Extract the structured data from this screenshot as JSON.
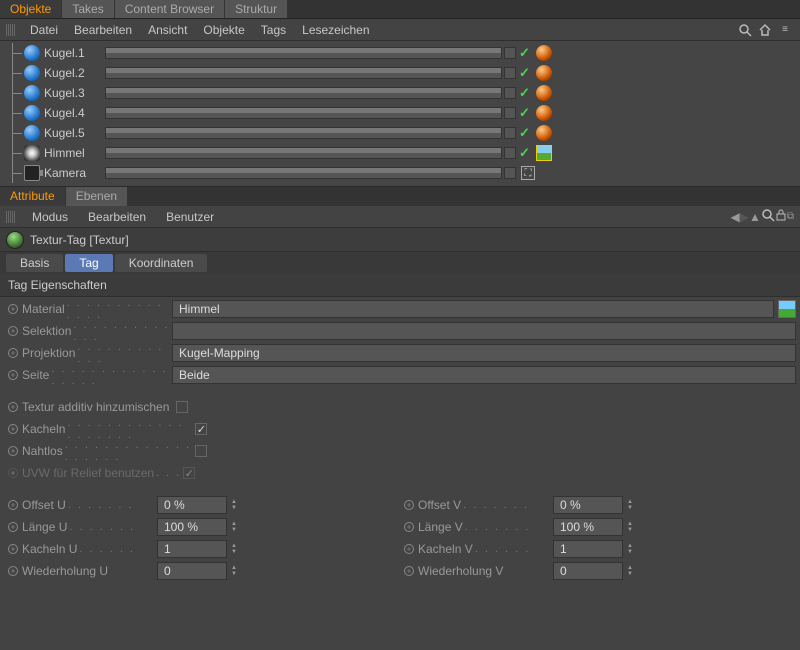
{
  "topTabs": {
    "active": "Objekte",
    "items": [
      "Objekte",
      "Takes",
      "Content Browser",
      "Struktur"
    ]
  },
  "objMenu": [
    "Datei",
    "Bearbeiten",
    "Ansicht",
    "Objekte",
    "Tags",
    "Lesezeichen"
  ],
  "objects": [
    {
      "name": "Kugel.1",
      "type": "sphere"
    },
    {
      "name": "Kugel.2",
      "type": "sphere"
    },
    {
      "name": "Kugel.3",
      "type": "sphere"
    },
    {
      "name": "Kugel.4",
      "type": "sphere"
    },
    {
      "name": "Kugel.5",
      "type": "sphere"
    },
    {
      "name": "Himmel",
      "type": "sky"
    },
    {
      "name": "Kamera",
      "type": "camera"
    }
  ],
  "attrTabs": {
    "active": "Attribute",
    "items": [
      "Attribute",
      "Ebenen"
    ]
  },
  "attrMenu": [
    "Modus",
    "Bearbeiten",
    "Benutzer"
  ],
  "headTitle": "Textur-Tag [Textur]",
  "subTabs": [
    "Basis",
    "Tag",
    "Koordinaten"
  ],
  "subActive": "Tag",
  "sectionTitle": "Tag Eigenschaften",
  "props": {
    "material": {
      "label": "Material",
      "value": "Himmel"
    },
    "selektion": {
      "label": "Selektion",
      "value": ""
    },
    "projektion": {
      "label": "Projektion",
      "value": "Kugel-Mapping"
    },
    "seite": {
      "label": "Seite",
      "value": "Beide"
    },
    "additiv": {
      "label": "Textur additiv hinzumischen",
      "checked": false
    },
    "kacheln": {
      "label": "Kacheln",
      "checked": true
    },
    "nahtlos": {
      "label": "Nahtlos",
      "checked": false
    },
    "uvw": {
      "label": "UVW für Relief benutzen",
      "checked": true,
      "enabled": false
    },
    "offsetU": {
      "label": "Offset U",
      "value": "0 %"
    },
    "offsetV": {
      "label": "Offset V",
      "value": "0 %"
    },
    "laengeU": {
      "label": "Länge U",
      "value": "100 %"
    },
    "laengeV": {
      "label": "Länge V",
      "value": "100 %"
    },
    "kachelnU": {
      "label": "Kacheln U",
      "value": "1"
    },
    "kachelnV": {
      "label": "Kacheln V",
      "value": "1"
    },
    "wiederU": {
      "label": "Wiederholung U",
      "value": "0"
    },
    "wiederV": {
      "label": "Wiederholung V",
      "value": "0"
    }
  }
}
